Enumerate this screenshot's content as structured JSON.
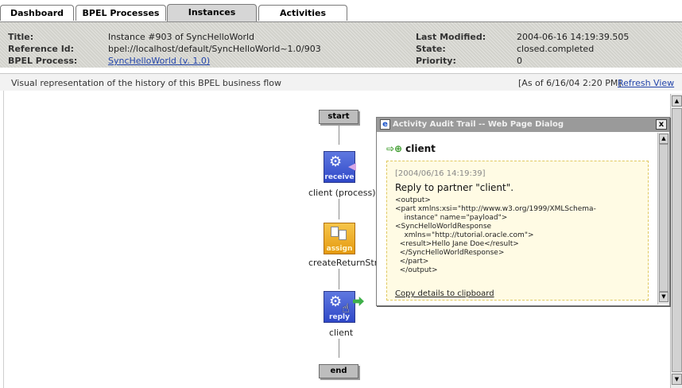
{
  "tabs": [
    {
      "label": "Dashboard",
      "active": false
    },
    {
      "label": "BPEL Processes",
      "active": false
    },
    {
      "label": "Instances",
      "active": true
    },
    {
      "label": "Activities",
      "active": false
    }
  ],
  "info": {
    "title_label": "Title:",
    "title_value": "Instance #903 of SyncHelloWorld",
    "reference_label": "Reference Id:",
    "reference_value": "bpel://localhost/default/SyncHelloWorld~1.0/903",
    "process_label": "BPEL Process:",
    "process_value": "SyncHelloWorld (v. 1.0)",
    "modified_label": "Last Modified:",
    "modified_value": "2004-06-16 14:19:39.505",
    "state_label": "State:",
    "state_value": "closed.completed",
    "priority_label": "Priority:",
    "priority_value": "0"
  },
  "caption": {
    "description": "Visual representation of the history of this BPEL business flow",
    "as_of": "[As of 6/16/04 2:20 PM]",
    "refresh": "Refresh View"
  },
  "flow": {
    "start": "start",
    "end": "end",
    "activities": [
      {
        "tag": "receive",
        "label": "client (process)",
        "icon": "gear-icon"
      },
      {
        "tag": "assign",
        "label": "createReturnStr",
        "icon": "document-icon"
      },
      {
        "tag": "reply",
        "label": "client",
        "icon": "gear-icon"
      }
    ]
  },
  "dialog": {
    "title": "Activity Audit Trail -- Web Page Dialog",
    "header": "client",
    "timestamp": "[2004/06/16 14:19:39]",
    "message": "Reply to partner \"client\".",
    "payload": "<output>\n<part xmlns:xsi=\"http://www.w3.org/1999/XMLSchema-\n    instance\" name=\"payload\">\n<SyncHelloWorldResponse\n    xmlns=\"http://tutorial.oracle.com\">\n  <result>Hello Jane Doe</result>\n  </SyncHelloWorldResponse>\n  </part>\n  </output>",
    "copy_link": "Copy details to clipboard",
    "close": "x"
  }
}
